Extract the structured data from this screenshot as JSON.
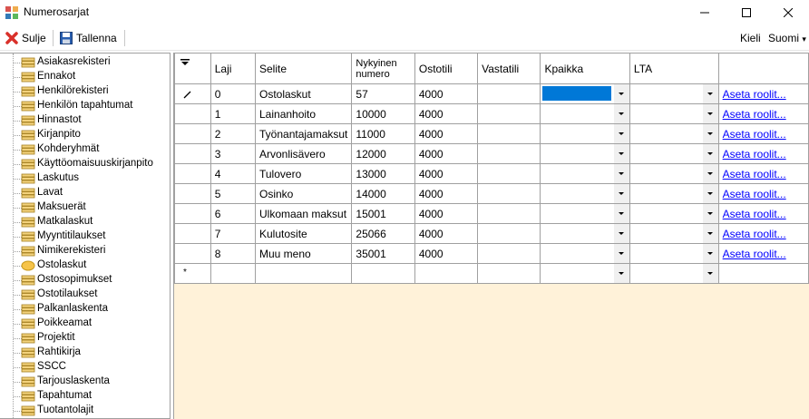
{
  "window": {
    "title": "Numerosarjat",
    "minimize_icon": "minimize-icon",
    "maximize_icon": "maximize-icon",
    "close_icon": "close-icon"
  },
  "toolbar": {
    "close_label": "Sulje",
    "save_label": "Tallenna",
    "language_label": "Kieli",
    "language_value": "Suomi"
  },
  "tree": {
    "items": [
      "Asiakasrekisteri",
      "Ennakot",
      "Henkilörekisteri",
      "Henkilön tapahtumat",
      "Hinnastot",
      "Kirjanpito",
      "Kohderyhmät",
      "Käyttöomaisuuskirjanpito",
      "Laskutus",
      "Lavat",
      "Maksuerät",
      "Matkalaskut",
      "Myyntitilaukset",
      "Nimikerekisteri",
      "Ostolaskut",
      "Ostosopimukset",
      "Ostotilaukset",
      "Palkanlaskenta",
      "Poikkeamat",
      "Projektit",
      "Rahtikirja",
      "SSCC",
      "Tarjouslaskenta",
      "Tapahtumat",
      "Tuotantolajit"
    ],
    "selected_index": 14
  },
  "grid": {
    "headers": {
      "laji": "Laji",
      "selite": "Selite",
      "nykyinen_1": "Nykyinen",
      "nykyinen_2": "numero",
      "ostotili": "Ostotili",
      "vastatili": "Vastatili",
      "kpaikka": "Kpaikka",
      "lta": "LTA"
    },
    "rows": [
      {
        "laji": "0",
        "selite": "Ostolaskut",
        "numero": "57",
        "ostotili": "4000",
        "link": "Aseta roolit..."
      },
      {
        "laji": "1",
        "selite": "Lainanhoito",
        "numero": "10000",
        "ostotili": "4000",
        "link": "Aseta roolit..."
      },
      {
        "laji": "2",
        "selite": "Työnantajamaksut",
        "numero": "11000",
        "ostotili": "4000",
        "link": "Aseta roolit..."
      },
      {
        "laji": "3",
        "selite": "Arvonlisävero",
        "numero": "12000",
        "ostotili": "4000",
        "link": "Aseta roolit..."
      },
      {
        "laji": "4",
        "selite": "Tulovero",
        "numero": "13000",
        "ostotili": "4000",
        "link": "Aseta roolit..."
      },
      {
        "laji": "5",
        "selite": "Osinko",
        "numero": "14000",
        "ostotili": "4000",
        "link": "Aseta roolit..."
      },
      {
        "laji": "6",
        "selite": "Ulkomaan maksut",
        "numero": "15001",
        "ostotili": "4000",
        "link": "Aseta roolit..."
      },
      {
        "laji": "7",
        "selite": "Kulutosite",
        "numero": "25066",
        "ostotili": "4000",
        "link": "Aseta roolit..."
      },
      {
        "laji": "8",
        "selite": "Muu meno",
        "numero": "35001",
        "ostotili": "4000",
        "link": "Aseta roolit..."
      }
    ]
  }
}
